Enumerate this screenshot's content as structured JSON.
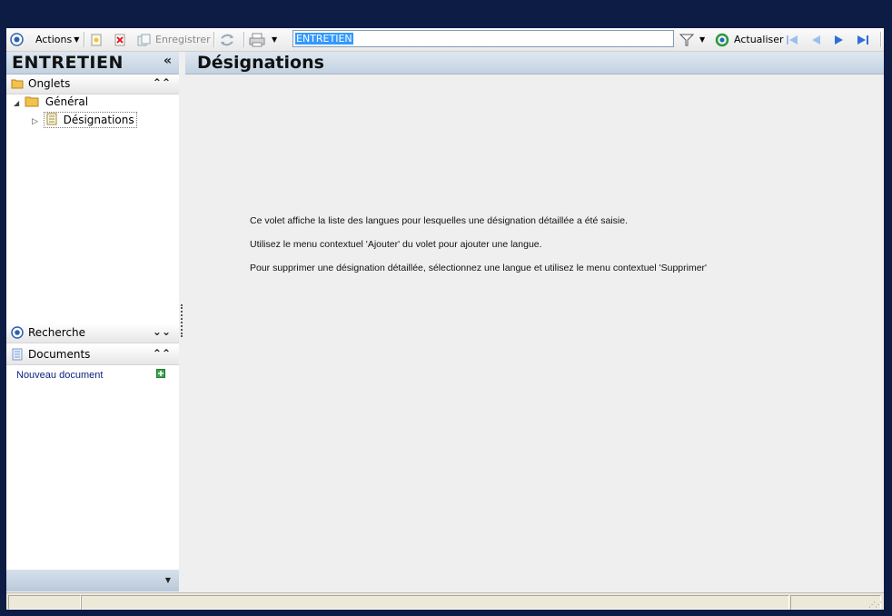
{
  "toolbar": {
    "actions_label": "Actions",
    "save_label": "Enregistrer",
    "search_value": "ENTRETIEN",
    "refresh_label": "Actualiser"
  },
  "left_panel": {
    "title": "ENTRETIEN",
    "collapse_glyph": "«",
    "sections": {
      "onglets": {
        "label": "Onglets",
        "chevron": "⌃"
      },
      "recherche": {
        "label": "Recherche",
        "chevron": "⌄"
      },
      "documents": {
        "label": "Documents",
        "chevron": "⌃"
      }
    },
    "tree": {
      "root_label": "Général",
      "child_label": "Désignations"
    },
    "documents_link": "Nouveau document"
  },
  "main": {
    "title": "Désignations",
    "messages": [
      "Ce volet affiche la liste des langues pour lesquelles une désignation détaillée a été saisie.",
      "Utilisez le menu contextuel 'Ajouter' du volet pour ajouter une langue.",
      "Pour supprimer une désignation détaillée, sélectionnez une langue et utilisez le menu contextuel 'Supprimer'"
    ]
  },
  "colors": {
    "window_bg": "#0c1c44",
    "panel_header": "#c2d1e1",
    "selection": "#3399ff",
    "link": "#0a1f7a",
    "nav_arrow": "#2e6fd6"
  },
  "icons": [
    "circle-target-icon",
    "new-doc-icon",
    "delete-icon",
    "save-icon",
    "sync-icon",
    "print-icon",
    "filter-icon",
    "refresh-icon",
    "first-icon",
    "prev-icon",
    "next-icon",
    "last-icon",
    "folder-icon",
    "doc-icon",
    "add-icon"
  ]
}
